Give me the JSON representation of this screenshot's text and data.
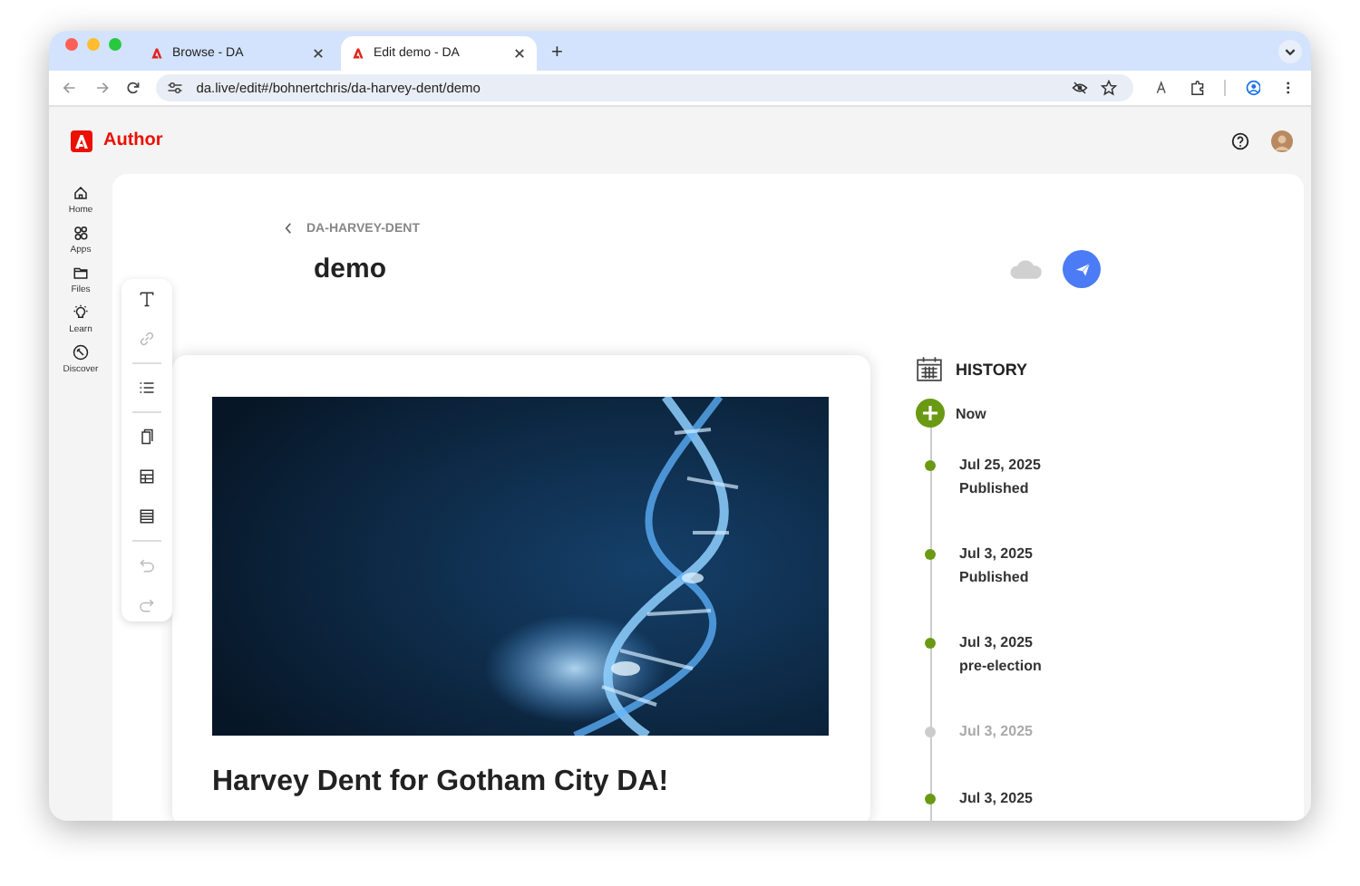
{
  "browser": {
    "tabs": [
      {
        "title": "Browse - DA",
        "selected": false
      },
      {
        "title": "Edit demo - DA",
        "selected": true
      }
    ],
    "new_tab": "+",
    "url": "da.live/edit#/bohnertchris/da-harvey-dent/demo"
  },
  "app": {
    "name": "Author"
  },
  "sidebar": {
    "items": [
      {
        "label": "Home"
      },
      {
        "label": "Apps"
      },
      {
        "label": "Files"
      },
      {
        "label": "Learn"
      },
      {
        "label": "Discover"
      }
    ]
  },
  "document": {
    "breadcrumb": "DA-HARVEY-DENT",
    "title": "demo",
    "heading": "Harvey Dent for Gotham City DA!"
  },
  "toolbar": {
    "groups": [
      [
        {
          "disabled": false
        },
        {
          "disabled": true
        }
      ],
      [
        {
          "disabled": false
        }
      ],
      [
        {
          "disabled": false
        },
        {
          "disabled": false
        },
        {
          "disabled": false
        }
      ],
      [
        {
          "disabled": true
        },
        {
          "disabled": true
        }
      ]
    ]
  },
  "history": {
    "title": "HISTORY",
    "now": "Now",
    "entries": [
      {
        "date": "Jul 25, 2025",
        "label": "Published",
        "dimmed": false
      },
      {
        "date": "Jul 3, 2025",
        "label": "Published",
        "dimmed": false
      },
      {
        "date": "Jul 3, 2025",
        "label": "pre-election",
        "dimmed": false
      },
      {
        "date": "Jul 3, 2025",
        "dimmed": true
      },
      {
        "date": "Jul 3, 2025",
        "dimmed": false
      }
    ]
  }
}
